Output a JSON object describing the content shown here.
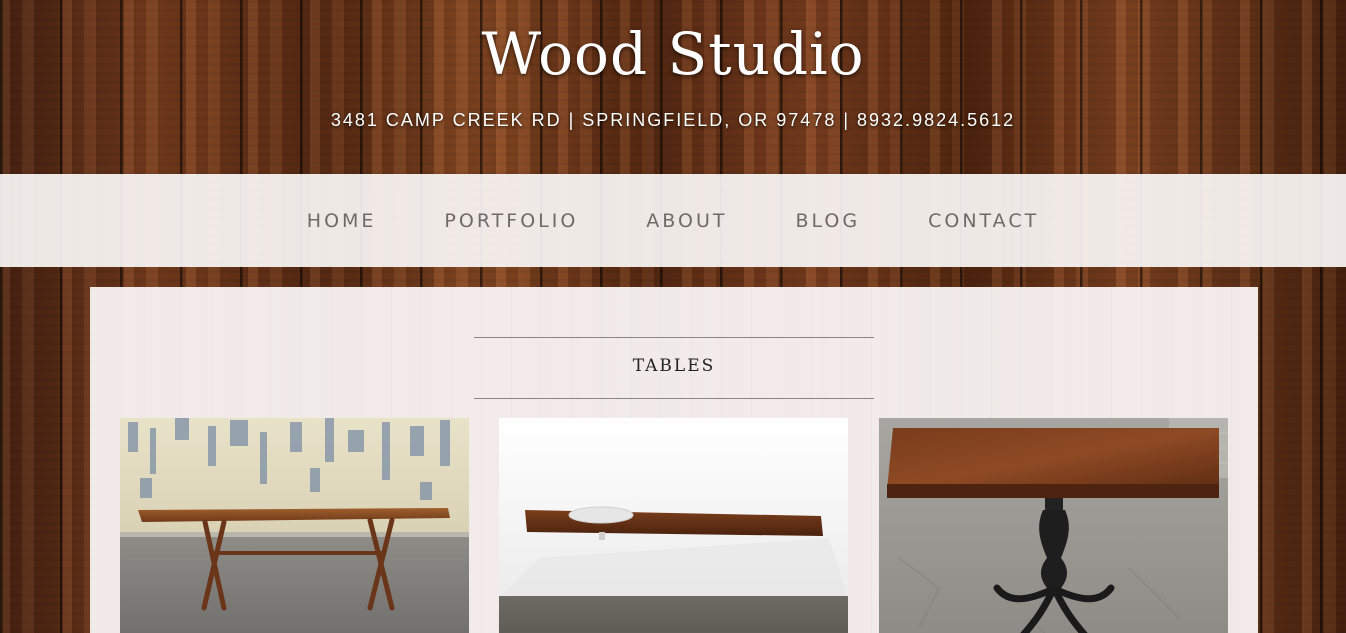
{
  "site": {
    "title": "Wood Studio",
    "address": "3481 CAMP CREEK RD | SPRINGFIELD, OR 97478 | 8932.9824.5612"
  },
  "nav": {
    "items": [
      {
        "label": "HOME"
      },
      {
        "label": "PORTFOLIO"
      },
      {
        "label": "ABOUT"
      },
      {
        "label": "BLOG"
      },
      {
        "label": "CONTACT"
      }
    ]
  },
  "main": {
    "section_title": "TABLES",
    "gallery": [
      {
        "image": "live-edge-table-on-crossed-legs"
      },
      {
        "image": "floating-wall-shelf-table"
      },
      {
        "image": "pedestal-table-with-iron-base"
      }
    ]
  },
  "colors": {
    "wood_dark": "#5a2e16",
    "nav_bg": "#f5f0ee",
    "nav_text": "#6f6a66",
    "heading_text": "#222222"
  }
}
